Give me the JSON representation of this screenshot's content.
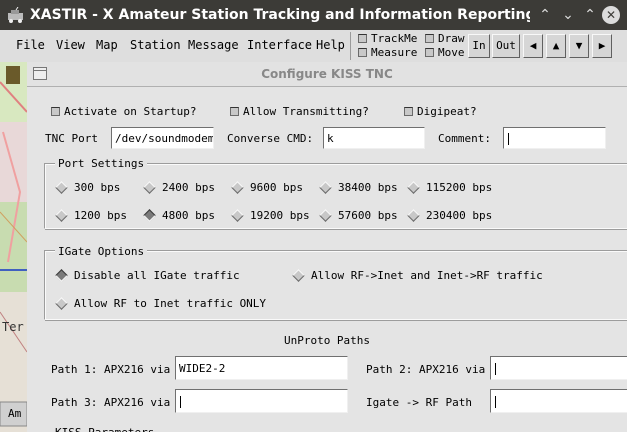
{
  "window": {
    "title": "XASTIR - X Amateur Station Tracking and Information Reporting @ debian"
  },
  "menubar": {
    "items": [
      "File",
      "View",
      "Map",
      "Station",
      "Message",
      "Interface",
      "Help"
    ],
    "toggles": [
      "TrackMe",
      "Measure",
      "Draw",
      "Move"
    ],
    "buttons": [
      "In",
      "Out"
    ]
  },
  "dialog": {
    "title": "Configure KISS TNC",
    "checkboxes": {
      "activate": "Activate on Startup?",
      "allow_tx": "Allow Transmitting?",
      "digipeat": "Digipeat?"
    },
    "tnc_port": {
      "label": "TNC Port",
      "value": "/dev/soundmodem"
    },
    "converse_cmd": {
      "label": "Converse CMD:",
      "value": "k"
    },
    "comment": {
      "label": "Comment:",
      "value": ""
    },
    "port_settings": {
      "title": "Port Settings",
      "rates": [
        "300 bps",
        "2400 bps",
        "9600 bps",
        "38400 bps",
        "115200 bps",
        "1200 bps",
        "4800 bps",
        "19200 bps",
        "57600 bps",
        "230400 bps"
      ],
      "selected": "4800 bps"
    },
    "igate": {
      "title": "IGate Options",
      "options": [
        "Disable all IGate traffic",
        "Allow RF->Inet and Inet->RF traffic",
        "Allow RF to Inet traffic ONLY"
      ],
      "selected": "Disable all IGate traffic"
    },
    "unproto": {
      "title": "UnProto Paths",
      "path1": {
        "label": "Path 1: APX216 via",
        "value": "WIDE2-2"
      },
      "path2": {
        "label": "Path 2: APX216 via",
        "value": ""
      },
      "path3": {
        "label": "Path 3: APX216 via",
        "value": ""
      },
      "igate_rf": {
        "label": "Igate -> RF Path",
        "value": ""
      }
    },
    "kiss_params_partial": "KISS Parameters"
  },
  "map": {
    "partial_text": [
      "Ter",
      "Am"
    ]
  }
}
